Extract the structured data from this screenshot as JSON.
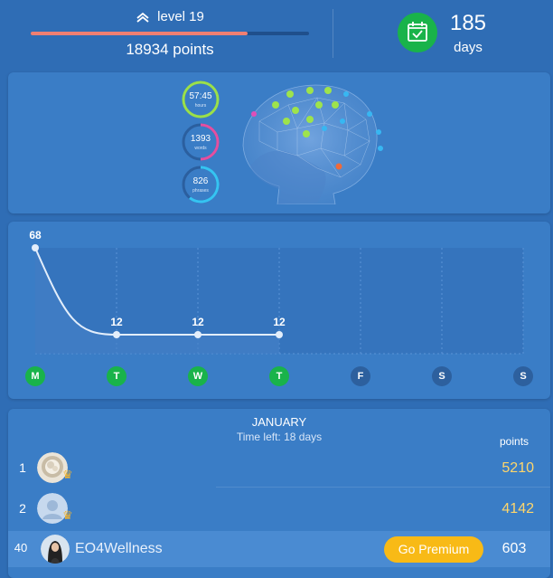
{
  "header": {
    "level_label": "level 19",
    "level_progress": 0.78,
    "points_label": "18934 points",
    "streak_days": "185",
    "streak_unit": "days"
  },
  "stats": [
    {
      "value": "57:45",
      "unit": "hours",
      "color": "#9be04a"
    },
    {
      "value": "1393",
      "unit": "words",
      "color": "#e44fa0"
    },
    {
      "value": "826",
      "unit": "phrases",
      "color": "#35c4f2"
    }
  ],
  "chart_data": {
    "type": "line",
    "categories": [
      "M",
      "T",
      "W",
      "T",
      "F",
      "S",
      "S"
    ],
    "values": [
      68,
      12,
      12,
      12,
      null,
      null,
      null
    ],
    "labels": [
      "68",
      "12",
      "12",
      "12",
      "",
      "",
      ""
    ],
    "active": [
      true,
      true,
      true,
      true,
      false,
      false,
      false
    ],
    "ylim": [
      0,
      68
    ]
  },
  "leaderboard": {
    "month": "JANUARY",
    "time_left": "Time left: 18 days",
    "points_header": "points",
    "rows": [
      {
        "rank": "1",
        "points": "5210"
      },
      {
        "rank": "2",
        "points": "4142"
      }
    ],
    "me": {
      "rank": "40",
      "name": "EO4Wellness",
      "button": "Go Premium",
      "points": "603"
    }
  }
}
